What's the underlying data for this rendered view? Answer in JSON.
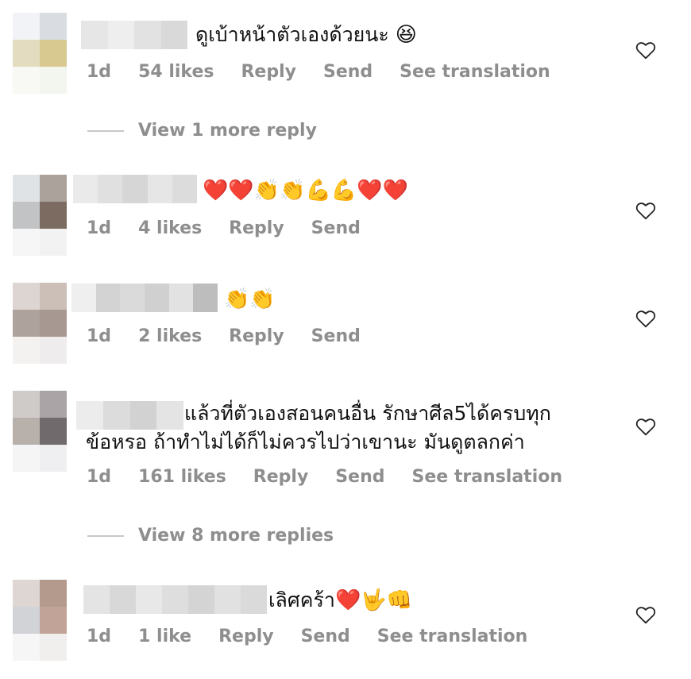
{
  "colors": {
    "meta_text": "#8e8e8e",
    "text": "#111111",
    "heart": "#ff3b30"
  },
  "comments": [
    {
      "text": "ดูเบ้าหน้าตัวเองด้วยนะ",
      "emoji": "😆",
      "time": "1d",
      "likes": "54 likes",
      "reply": "Reply",
      "send": "Send",
      "translate": "See translation"
    },
    {
      "text": "",
      "emoji": "❤️❤️👏👏💪💪❤️❤️",
      "time": "1d",
      "likes": "4 likes",
      "reply": "Reply",
      "send": "Send"
    },
    {
      "text": "",
      "emoji": "👏👏",
      "time": "1d",
      "likes": "2 likes",
      "reply": "Reply",
      "send": "Send"
    },
    {
      "text_line1": "แล้วที่ตัวเองสอนคนอื่น รักษาศีล5ได้ครบทุก",
      "text_line2": "ข้อหรอ ถ้าทำไม่ได้ก็ไม่ควรไปว่าเขานะ มันดูตลกค่า",
      "time": "1d",
      "likes": "161 likes",
      "reply": "Reply",
      "send": "Send",
      "translate": "See translation"
    },
    {
      "text": "เลิศคร้า",
      "emoji": "❤️🤟👊",
      "time": "1d",
      "likes": "1 like",
      "reply": "Reply",
      "send": "Send",
      "translate": "See translation"
    }
  ],
  "view_more": [
    {
      "label": "View 1 more reply"
    },
    {
      "label": "View 8 more replies"
    }
  ]
}
